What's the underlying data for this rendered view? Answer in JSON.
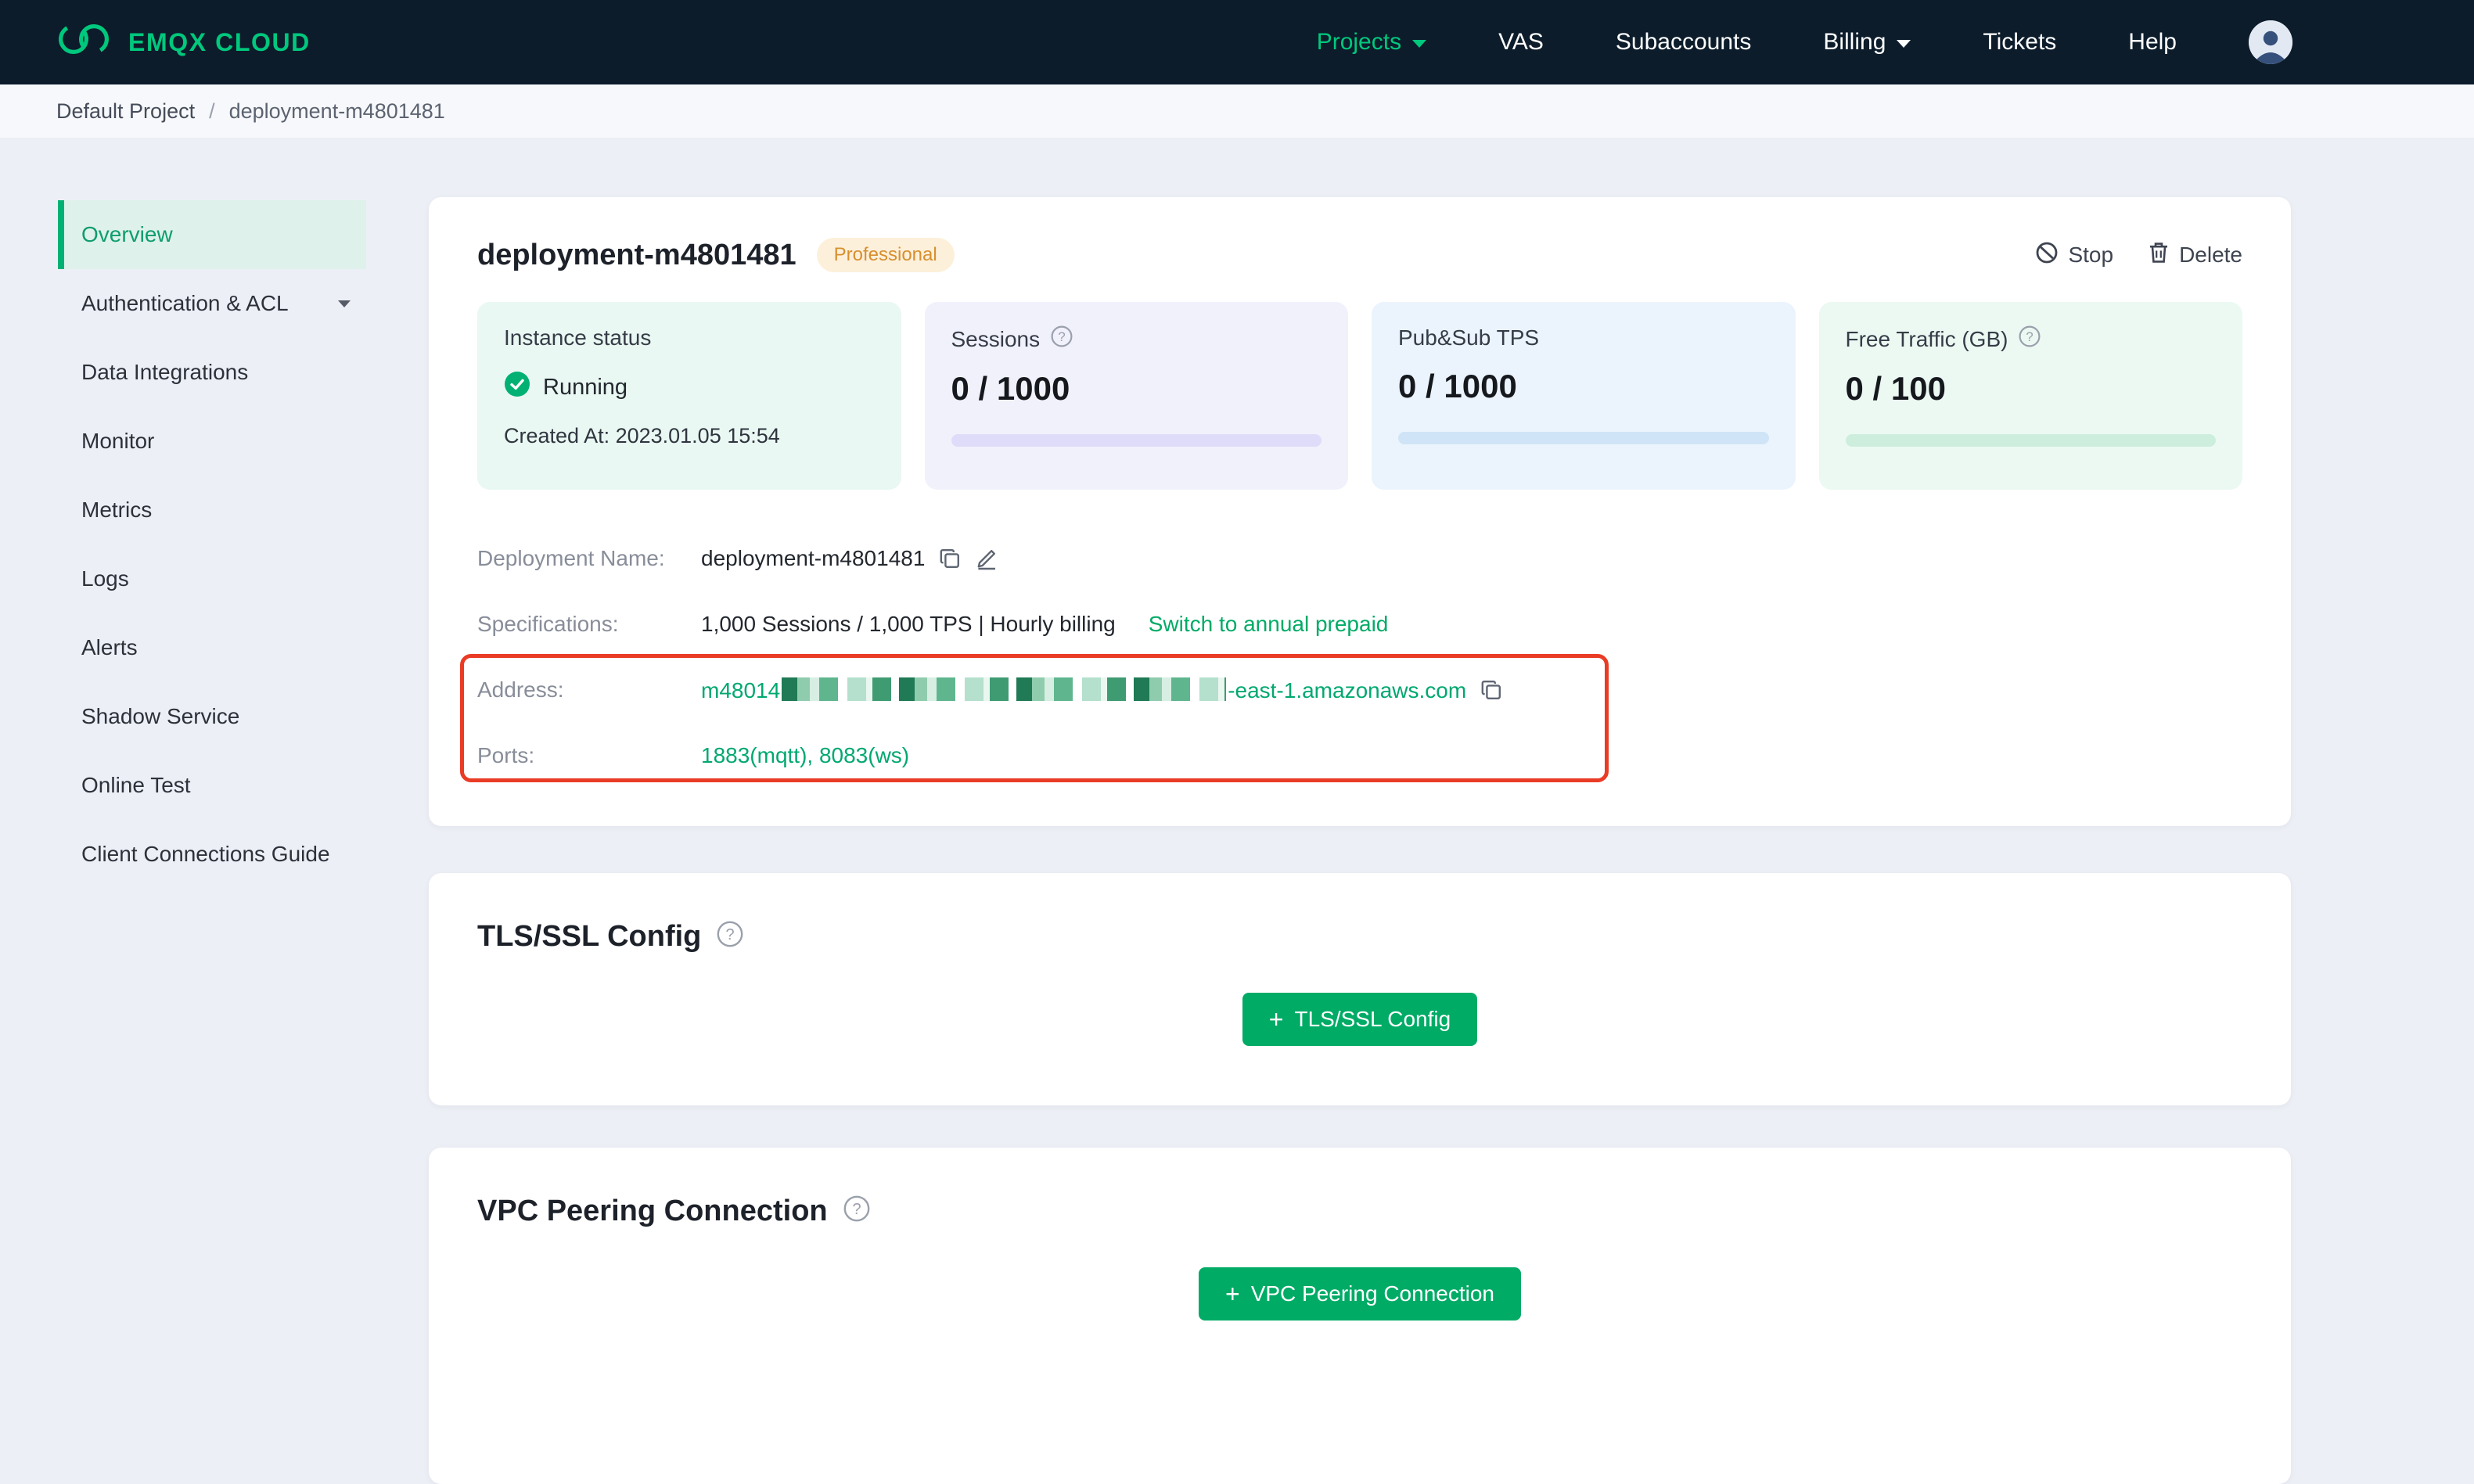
{
  "navbar": {
    "brand": "EMQX CLOUD",
    "items": [
      {
        "label": "Projects",
        "dropdown": true,
        "active": true
      },
      {
        "label": "VAS"
      },
      {
        "label": "Subaccounts"
      },
      {
        "label": "Billing",
        "dropdown": true
      },
      {
        "label": "Tickets"
      },
      {
        "label": "Help"
      }
    ]
  },
  "breadcrumb": {
    "project": "Default Project",
    "separator": "/",
    "current": "deployment-m4801481"
  },
  "sidebar": {
    "items": [
      {
        "label": "Overview",
        "active": true
      },
      {
        "label": "Authentication & ACL",
        "expandable": true
      },
      {
        "label": "Data Integrations"
      },
      {
        "label": "Monitor"
      },
      {
        "label": "Metrics"
      },
      {
        "label": "Logs"
      },
      {
        "label": "Alerts"
      },
      {
        "label": "Shadow Service"
      },
      {
        "label": "Online Test"
      },
      {
        "label": "Client Connections Guide"
      }
    ]
  },
  "deployment": {
    "title": "deployment-m4801481",
    "plan_badge": "Professional",
    "actions": {
      "stop": "Stop",
      "delete": "Delete"
    },
    "stats": {
      "status": {
        "title": "Instance status",
        "value": "Running",
        "created": "Created At: 2023.01.05 15:54"
      },
      "sessions": {
        "title": "Sessions",
        "value": "0 / 1000"
      },
      "tps": {
        "title": "Pub&Sub TPS",
        "value": "0 / 1000"
      },
      "traffic": {
        "title": "Free Traffic (GB)",
        "value": "0 / 100"
      }
    },
    "info": {
      "deployment_name_label": "Deployment Name:",
      "deployment_name_value": "deployment-m4801481",
      "specifications_label": "Specifications:",
      "specifications_value": "1,000 Sessions / 1,000 TPS | Hourly billing",
      "specifications_link": "Switch to annual prepaid",
      "address_label": "Address:",
      "address_prefix": "m48014",
      "address_suffix": "-east-1.amazonaws.com",
      "address_redacted": true,
      "ports_label": "Ports:",
      "ports_value": "1883(mqtt), 8083(ws)"
    }
  },
  "tls_card": {
    "title": "TLS/SSL Config",
    "button": "TLS/SSL Config",
    "plus": "+"
  },
  "vpc_card": {
    "title": "VPC Peering Connection",
    "button": "VPC Peering Connection",
    "plus": "+"
  },
  "colors": {
    "navbar_bg": "#0c1c2b",
    "brand_green": "#00c87d",
    "button_green": "#00ab66",
    "status_green": "#00b173",
    "badge_orange": "#d78f2f",
    "annotation_red": "#ea3b25",
    "page_bg": "#edeff6"
  }
}
